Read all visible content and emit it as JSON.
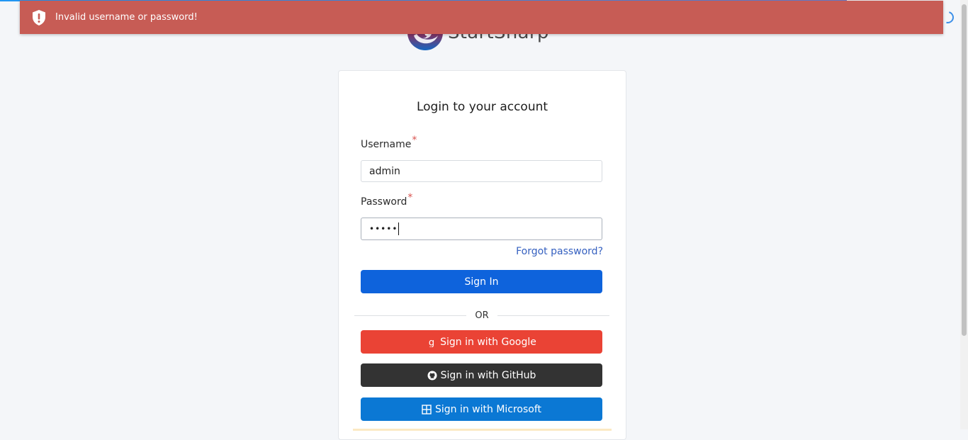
{
  "brand": {
    "name": "StartSharp",
    "logo_icon": "startsharp-logo"
  },
  "toast": {
    "message": "Invalid username or password!",
    "icon": "shield-exclamation-icon",
    "color": "#c75c55"
  },
  "login": {
    "title": "Login to your account",
    "username": {
      "label": "Username",
      "required_mark": "*",
      "value": "admin"
    },
    "password": {
      "label": "Password",
      "required_mark": "*",
      "masked_value": "•••••"
    },
    "forgot_link": "Forgot password?",
    "sign_in_button": "Sign In",
    "divider_text": "OR",
    "external": {
      "google": {
        "label": "Sign in with Google",
        "icon": "google-icon",
        "color": "#ea4335"
      },
      "github": {
        "label": "Sign in with GitHub",
        "icon": "github-icon",
        "color": "#333333"
      },
      "microsoft": {
        "label": "Sign in with Microsoft",
        "icon": "windows-icon",
        "color": "#0b78d4"
      }
    }
  },
  "colors": {
    "primary": "#0e63dc",
    "background": "#f4f6f9",
    "link": "#3560c0"
  }
}
